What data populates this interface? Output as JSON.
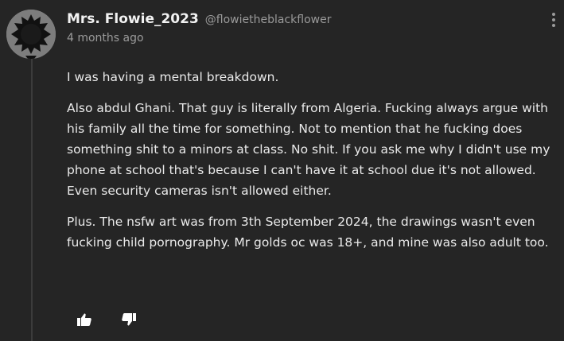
{
  "comment": {
    "display_name": "Mrs. Flowie_2023",
    "handle": "@flowietheblackflower",
    "timestamp": "4 months ago",
    "paragraphs": [
      "I was having a mental breakdown.",
      "Also abdul Ghani. That guy is literally from Algeria. Fucking always argue with his family all the time for something. Not to mention that he fucking does something shit to a minors at class. No shit. If you ask me why I didn't use my phone at school that's because I can't have it at school due it's not allowed. Even security cameras isn't allowed either.",
      "Plus. The nsfw art was from 3th September 2024, the drawings wasn't even fucking child pornography. Mr golds oc was 18+, and mine was also adult too."
    ]
  },
  "icons": {
    "avatar": "flower-silhouette-avatar",
    "menu": "more-vertical-icon",
    "like": "thumbs-up-icon",
    "dislike": "thumbs-down-icon"
  },
  "colors": {
    "background": "#252525",
    "text": "#eaeaea",
    "muted": "#9a9a9a"
  }
}
